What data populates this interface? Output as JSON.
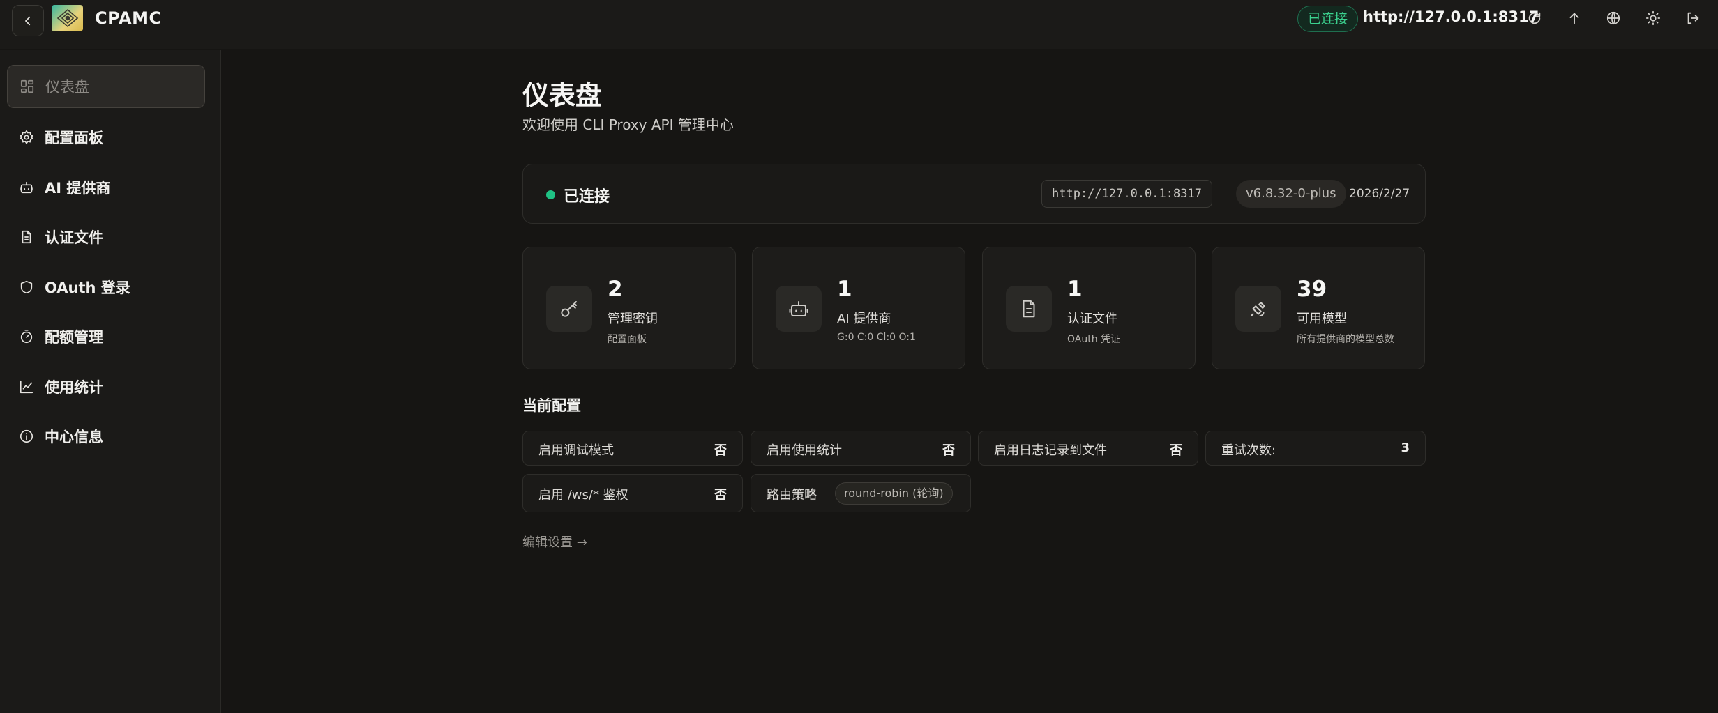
{
  "topbar": {
    "brand": "CPAMC",
    "connection_badge": "已连接",
    "server_url": "http://127.0.0.1:8317",
    "icons": [
      "back-icon",
      "logo-icon",
      "refresh-icon",
      "upload-icon",
      "globe-icon",
      "sun-icon",
      "logout-icon"
    ]
  },
  "sidebar": {
    "items": [
      {
        "label": "仪表盘",
        "icon": "dashboard-icon",
        "active": true
      },
      {
        "label": "配置面板",
        "icon": "gear-icon"
      },
      {
        "label": "AI 提供商",
        "icon": "robot-icon"
      },
      {
        "label": "认证文件",
        "icon": "file-icon"
      },
      {
        "label": "OAuth 登录",
        "icon": "shield-icon"
      },
      {
        "label": "配额管理",
        "icon": "timer-icon"
      },
      {
        "label": "使用统计",
        "icon": "chart-icon"
      },
      {
        "label": "中心信息",
        "icon": "info-icon"
      }
    ]
  },
  "main": {
    "title": "仪表盘",
    "subtitle": "欢迎使用 CLI Proxy API 管理中心",
    "status": {
      "text": "已连接",
      "url": "http://127.0.0.1:8317",
      "version": "v6.8.32-0-plus",
      "date": "2026/2/27",
      "dot_color": "#1fc184"
    },
    "stats": [
      {
        "value": "2",
        "label": "管理密钥",
        "sub": "配置面板",
        "icon": "key-icon"
      },
      {
        "value": "1",
        "label": "AI 提供商",
        "sub": "G:0 C:0 Cl:0 O:1",
        "icon": "robot-icon"
      },
      {
        "value": "1",
        "label": "认证文件",
        "sub": "OAuth 凭证",
        "icon": "file-icon"
      },
      {
        "value": "39",
        "label": "可用模型",
        "sub": "所有提供商的模型总数",
        "icon": "satellite-icon"
      }
    ],
    "config_title": "当前配置",
    "config": [
      {
        "key": "启用调试模式",
        "value": "否"
      },
      {
        "key": "启用使用统计",
        "value": "否"
      },
      {
        "key": "启用日志记录到文件",
        "value": "否"
      },
      {
        "key": "重试次数:",
        "value": "3"
      },
      {
        "key": "启用 /ws/* 鉴权",
        "value": "否"
      },
      {
        "key": "路由策略",
        "value": "round-robin (轮询)"
      }
    ],
    "edit_link": "编辑设置 →"
  }
}
